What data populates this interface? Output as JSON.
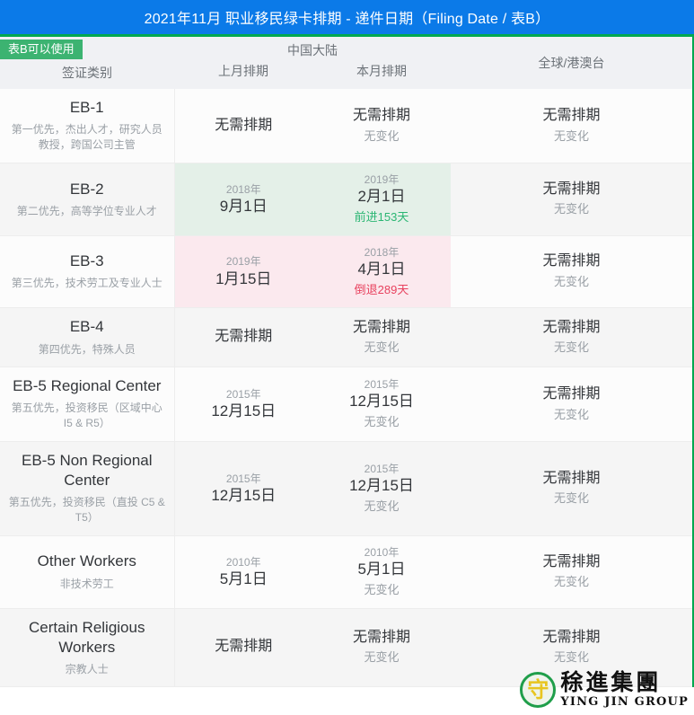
{
  "header": {
    "title": "2021年11月 职业移民绿卡排期 - 递件日期（Filing Date / 表B）",
    "bar_color": "#0b7ae8"
  },
  "badge": {
    "label": "表B可以使用",
    "color": "#3cb371"
  },
  "table": {
    "accent_color": "#00a850",
    "columns": {
      "category": "签证类别",
      "group_china": "中国大陆",
      "last_month": "上月排期",
      "this_month": "本月排期",
      "global": "全球/港澳台"
    },
    "rows": [
      {
        "title": "EB-1",
        "subtitle": "第一优先，杰出人才，研究人员\n教授，跨国公司主管",
        "last": {
          "year": "",
          "date": "无需排期",
          "note": "",
          "note_type": "none",
          "highlight": "none"
        },
        "current": {
          "year": "",
          "date": "无需排期",
          "note": "无变化",
          "note_type": "none",
          "highlight": "none"
        },
        "global": {
          "date": "无需排期",
          "note": "无变化"
        }
      },
      {
        "title": "EB-2",
        "subtitle": "第二优先，高等学位专业人才",
        "last": {
          "year": "2018年",
          "date": "9月1日",
          "note": "",
          "note_type": "none",
          "highlight": "green"
        },
        "current": {
          "year": "2019年",
          "date": "2月1日",
          "note": "前进153天",
          "note_type": "up",
          "highlight": "green"
        },
        "global": {
          "date": "无需排期",
          "note": "无变化"
        }
      },
      {
        "title": "EB-3",
        "subtitle": "第三优先，技术劳工及专业人士",
        "last": {
          "year": "2019年",
          "date": "1月15日",
          "note": "",
          "note_type": "none",
          "highlight": "pink"
        },
        "current": {
          "year": "2018年",
          "date": "4月1日",
          "note": "倒退289天",
          "note_type": "down",
          "highlight": "pink"
        },
        "global": {
          "date": "无需排期",
          "note": "无变化"
        }
      },
      {
        "title": "EB-4",
        "subtitle": "第四优先，特殊人员",
        "last": {
          "year": "",
          "date": "无需排期",
          "note": "",
          "note_type": "none",
          "highlight": "none"
        },
        "current": {
          "year": "",
          "date": "无需排期",
          "note": "无变化",
          "note_type": "none",
          "highlight": "none"
        },
        "global": {
          "date": "无需排期",
          "note": "无变化"
        }
      },
      {
        "title": "EB-5 Regional Center",
        "subtitle": "第五优先，投资移民（区域中心 I5 & R5）",
        "last": {
          "year": "2015年",
          "date": "12月15日",
          "note": "",
          "note_type": "none",
          "highlight": "none"
        },
        "current": {
          "year": "2015年",
          "date": "12月15日",
          "note": "无变化",
          "note_type": "none",
          "highlight": "none"
        },
        "global": {
          "date": "无需排期",
          "note": "无变化"
        }
      },
      {
        "title": "EB-5 Non Regional Center",
        "subtitle": "第五优先，投资移民（直投 C5 & T5）",
        "last": {
          "year": "2015年",
          "date": "12月15日",
          "note": "",
          "note_type": "none",
          "highlight": "none"
        },
        "current": {
          "year": "2015年",
          "date": "12月15日",
          "note": "无变化",
          "note_type": "none",
          "highlight": "none"
        },
        "global": {
          "date": "无需排期",
          "note": "无变化"
        }
      },
      {
        "title": "Other Workers",
        "subtitle": "非技术劳工",
        "last": {
          "year": "2010年",
          "date": "5月1日",
          "note": "",
          "note_type": "none",
          "highlight": "none"
        },
        "current": {
          "year": "2010年",
          "date": "5月1日",
          "note": "无变化",
          "note_type": "none",
          "highlight": "none"
        },
        "global": {
          "date": "无需排期",
          "note": "无变化"
        }
      },
      {
        "title": "Certain Religious Workers",
        "subtitle": "宗教人士",
        "last": {
          "year": "",
          "date": "无需排期",
          "note": "",
          "note_type": "none",
          "highlight": "none"
        },
        "current": {
          "year": "",
          "date": "无需排期",
          "note": "无变化",
          "note_type": "none",
          "highlight": "none"
        },
        "global": {
          "date": "无需排期",
          "note": "无变化"
        }
      }
    ]
  },
  "logo": {
    "emblem_char": "守",
    "cn": "稌進集團",
    "en": "YING JIN GROUP"
  }
}
